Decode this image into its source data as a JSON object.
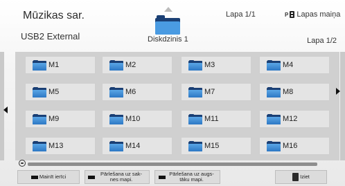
{
  "header": {
    "title": "Mūzikas sar.",
    "device": "USB2 External",
    "page_top": "Lapa 1/1",
    "page_change": "Lapas maiņa",
    "page_change_key": "P",
    "page_right": "Lapa 1/2",
    "disk_label": "Diskdzinis 1"
  },
  "folders": [
    "M1",
    "M2",
    "M3",
    "M4",
    "M5",
    "M6",
    "M7",
    "M8",
    "M9",
    "M10",
    "M11",
    "M12",
    "M13",
    "M14",
    "M15",
    "M16"
  ],
  "footer": {
    "change_device": "Mainīt ierīci",
    "go_root": "Pārlešana uz sak-nes mapi.",
    "go_up": "Pārlešana uz augs-tāku mapi.",
    "exit": "Iziet"
  },
  "colors": {
    "folder_front": "#3b8ed8",
    "folder_back": "#1a3f74",
    "grid_bg": "#d0d0d0",
    "tile_bg": "#e4e4e4"
  }
}
